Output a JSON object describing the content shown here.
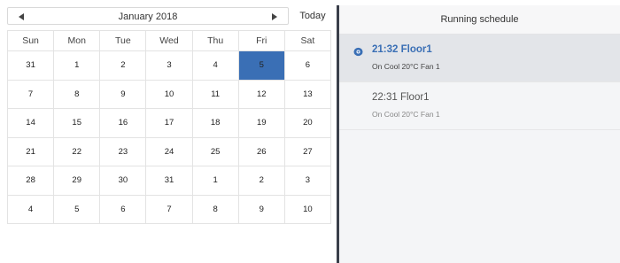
{
  "calendar": {
    "month_label": "January  2018",
    "today_label": "Today",
    "weekdays": [
      "Sun",
      "Mon",
      "Tue",
      "Wed",
      "Thu",
      "Fri",
      "Sat"
    ],
    "weeks": [
      [
        {
          "d": "31",
          "t": "muted"
        },
        {
          "d": "1",
          "t": ""
        },
        {
          "d": "2",
          "t": ""
        },
        {
          "d": "3",
          "t": ""
        },
        {
          "d": "4",
          "t": ""
        },
        {
          "d": "5",
          "t": "selected"
        },
        {
          "d": "6",
          "t": "weekend"
        }
      ],
      [
        {
          "d": "7",
          "t": "weekend"
        },
        {
          "d": "8",
          "t": ""
        },
        {
          "d": "9",
          "t": ""
        },
        {
          "d": "10",
          "t": ""
        },
        {
          "d": "11",
          "t": ""
        },
        {
          "d": "12",
          "t": ""
        },
        {
          "d": "13",
          "t": "weekend"
        }
      ],
      [
        {
          "d": "14",
          "t": "weekend"
        },
        {
          "d": "15",
          "t": ""
        },
        {
          "d": "16",
          "t": ""
        },
        {
          "d": "17",
          "t": ""
        },
        {
          "d": "18",
          "t": ""
        },
        {
          "d": "19",
          "t": ""
        },
        {
          "d": "20",
          "t": "weekend"
        }
      ],
      [
        {
          "d": "21",
          "t": "weekend"
        },
        {
          "d": "22",
          "t": ""
        },
        {
          "d": "23",
          "t": ""
        },
        {
          "d": "24",
          "t": ""
        },
        {
          "d": "25",
          "t": ""
        },
        {
          "d": "26",
          "t": ""
        },
        {
          "d": "27",
          "t": "weekend"
        }
      ],
      [
        {
          "d": "28",
          "t": "weekend"
        },
        {
          "d": "29",
          "t": ""
        },
        {
          "d": "30",
          "t": ""
        },
        {
          "d": "31",
          "t": ""
        },
        {
          "d": "1",
          "t": "muted"
        },
        {
          "d": "2",
          "t": "muted"
        },
        {
          "d": "3",
          "t": "muted"
        }
      ],
      [
        {
          "d": "4",
          "t": "muted"
        },
        {
          "d": "5",
          "t": "muted"
        },
        {
          "d": "6",
          "t": "muted"
        },
        {
          "d": "7",
          "t": "muted"
        },
        {
          "d": "8",
          "t": "muted"
        },
        {
          "d": "9",
          "t": "muted"
        },
        {
          "d": "10",
          "t": "muted"
        }
      ]
    ],
    "icons": {
      "prev": "chevron-left-icon",
      "next": "chevron-right-icon"
    }
  },
  "schedule": {
    "header": "Running schedule",
    "items": [
      {
        "title": "21:32 Floor1",
        "subtitle": "On Cool 20°C Fan 1",
        "active": true,
        "icon": "eye-icon"
      },
      {
        "title": "22:31 Floor1",
        "subtitle": "On Cool 20°C Fan 1",
        "active": false
      }
    ]
  },
  "colors": {
    "accent": "#3a6fb5",
    "divider": "#3a3f4a",
    "muted": "#a8a8a8"
  }
}
